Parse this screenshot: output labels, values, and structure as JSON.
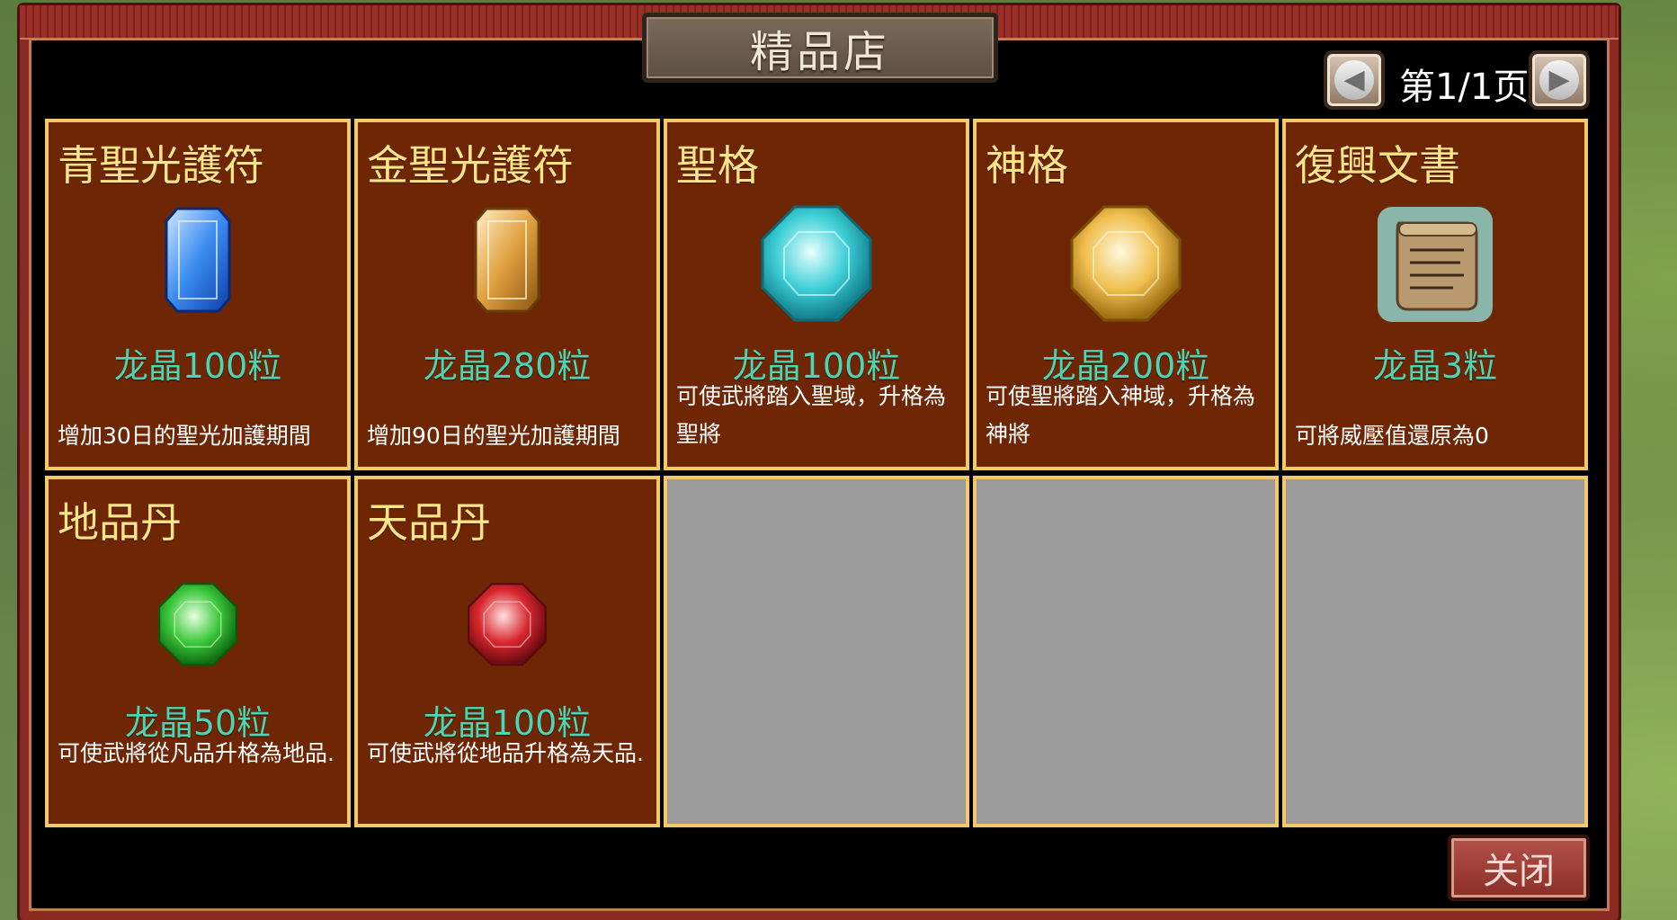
{
  "window": {
    "title": "精品店"
  },
  "pager": {
    "label": "第1/1页",
    "prev_icon": "left-arrow-icon",
    "next_icon": "right-arrow-icon"
  },
  "items": [
    {
      "name": "青聖光護符",
      "price": "龙晶100粒",
      "desc": "增加30日的聖光加護期間",
      "icon": "blue-rectangular-gem",
      "color": "#3b8bf0"
    },
    {
      "name": "金聖光護符",
      "price": "龙晶280粒",
      "desc": "增加90日的聖光加護期間",
      "icon": "gold-rectangular-gem",
      "color": "#e0a040"
    },
    {
      "name": "聖格",
      "price": "龙晶100粒",
      "desc": "可使武將踏入聖域，升格為聖將",
      "icon": "cyan-octagonal-gem",
      "color": "#3dcfd6"
    },
    {
      "name": "神格",
      "price": "龙晶200粒",
      "desc": "可使聖將踏入神域，升格為神將",
      "icon": "gold-octagonal-gem",
      "color": "#f0c050"
    },
    {
      "name": "復興文書",
      "price": "龙晶3粒",
      "desc": "可將威壓值還原為0",
      "icon": "scroll-icon",
      "color": "#8fd0c8"
    },
    {
      "name": "地品丹",
      "price": "龙晶50粒",
      "desc": "可使武將從凡品升格為地品.",
      "icon": "green-octagonal-gem",
      "color": "#3cc83c"
    },
    {
      "name": "天品丹",
      "price": "龙晶100粒",
      "desc": "可使武將從地品升格為天品.",
      "icon": "red-octagonal-gem",
      "color": "#d8262e"
    }
  ],
  "empty_slots": 3,
  "close_button": {
    "label": "关闭"
  }
}
